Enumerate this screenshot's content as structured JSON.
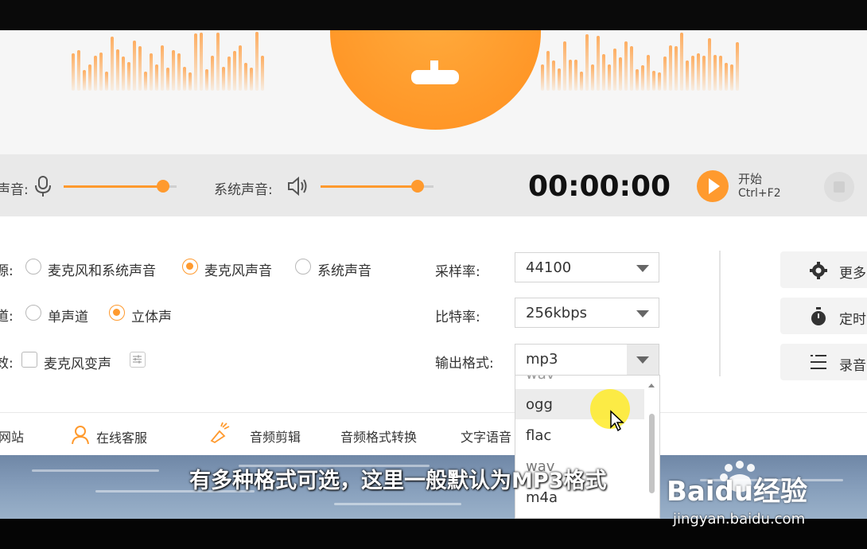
{
  "controls": {
    "mic_label": "声音:",
    "system_label": "系统声音:",
    "timer": "00:00:00",
    "start_label": "开始",
    "start_hotkey": "Ctrl+F2",
    "mic_volume": 0.85,
    "system_volume": 0.85
  },
  "settings": {
    "source_label": "源:",
    "source_options": [
      "麦克风和系统声音",
      "麦克风声音",
      "系统声音"
    ],
    "source_selected": "麦克风声音",
    "channel_label": "道:",
    "channel_options": [
      "单声道",
      "立体声"
    ],
    "channel_selected": "立体声",
    "effect_label": "效:",
    "mic_voice_change": "麦克风变声",
    "mic_voice_change_checked": false,
    "sample_rate_label": "采样率:",
    "sample_rate_value": "44100",
    "bitrate_label": "比特率:",
    "bitrate_value": "256kbps",
    "output_format_label": "输出格式:",
    "output_format_value": "mp3",
    "format_options": [
      "ogg",
      "flac",
      "wav",
      "m4a"
    ],
    "format_hovered": "ogg"
  },
  "side_buttons": [
    "更多",
    "定时",
    "录音"
  ],
  "toolbar": {
    "website": "网站",
    "support": "在线客服",
    "audio_edit": "音频剪辑",
    "format_convert": "音频格式转换",
    "text_voice": "文字语音"
  },
  "video": {
    "subtitle": "有多种格式可选，这里一般默认为MP3格式",
    "watermark_logo": "Baidu经验",
    "watermark_url": "jingyan.baidu.com"
  },
  "icons": {
    "mic": "microphone-icon",
    "speaker": "speaker-icon",
    "play": "play-icon",
    "stop": "stop-icon",
    "gear": "gear-icon",
    "timer": "timer-icon",
    "list": "list-icon",
    "support": "person-icon",
    "edit": "scissors-icon"
  },
  "colors": {
    "accent": "#ff9a2e"
  }
}
